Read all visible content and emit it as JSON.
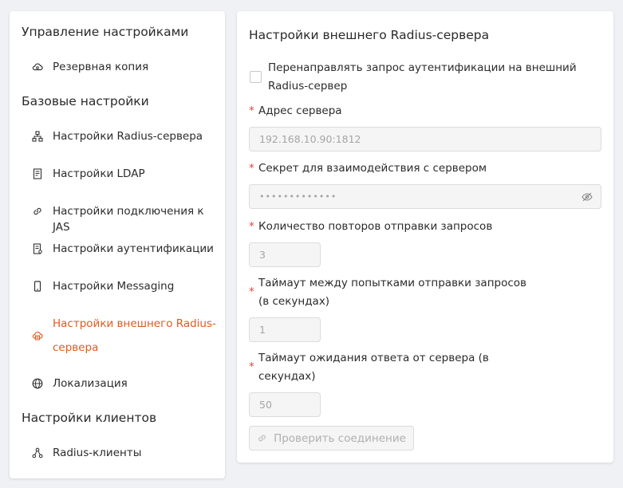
{
  "sidebar": {
    "sections": [
      {
        "title": "Управление настройками"
      },
      {
        "title": "Базовые настройки"
      },
      {
        "title": "Настройки клиентов"
      }
    ],
    "items": [
      {
        "label": "Резервная копия",
        "icon": "cloud-backup-icon"
      },
      {
        "label": "Настройки Radius-сервера",
        "icon": "network-icon"
      },
      {
        "label": "Настройки LDAP",
        "icon": "document-icon"
      },
      {
        "label": "Настройки подключения к JAS",
        "icon": "link-icon"
      },
      {
        "label": "Настройки аутентификации",
        "icon": "auth-document-icon"
      },
      {
        "label": "Настройки Messaging",
        "icon": "phone-icon"
      },
      {
        "label": "Настройки внешнего Radius-сервера",
        "icon": "cloud-server-icon"
      },
      {
        "label": "Локализация",
        "icon": "globe-icon"
      },
      {
        "label": "Radius-клиенты",
        "icon": "clients-icon"
      }
    ],
    "active_color": "#e15a1f"
  },
  "main": {
    "title": "Настройки внешнего Radius-сервера",
    "redirect_checkbox": {
      "label": "Перенаправлять запрос аутентификации на внешний Radius-сервер",
      "checked": false
    },
    "server_address": {
      "label": "Адрес сервера",
      "value": "192.168.10.90:1812"
    },
    "secret": {
      "label": "Секрет для взаимодействия с сервером",
      "value": "•••••••••••••"
    },
    "retry_count": {
      "label": "Количество повторов отправки запросов",
      "value": "3"
    },
    "retry_timeout": {
      "label_line1": "Таймаут между попытками отправки запросов",
      "label_line2": "(в секундах)",
      "value": "1"
    },
    "response_timeout": {
      "label_line1": "Таймаут ожидания ответа от сервера (в",
      "label_line2": "секундах)",
      "value": "50"
    },
    "required_mark": "*",
    "check_button_label": "Проверить соединение"
  }
}
